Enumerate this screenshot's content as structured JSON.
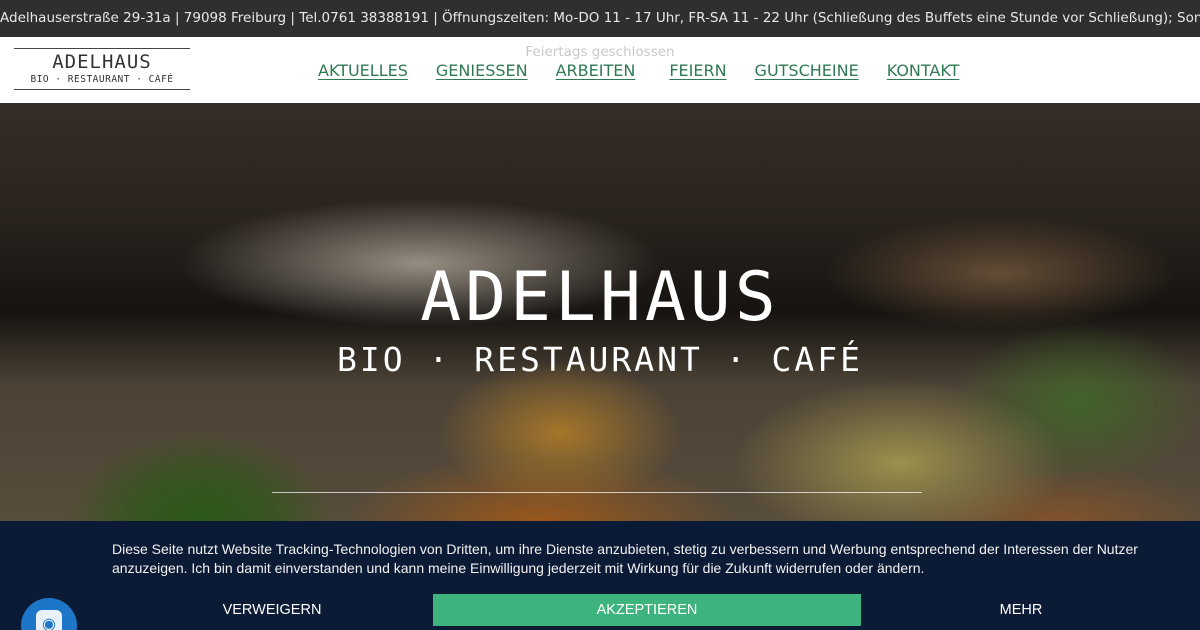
{
  "topbar": {
    "info": "Adelhauserstraße 29-31a | 79098 Freiburg | Tel.0761 38388191 | Öffnungszeiten: Mo-DO 11 - 17 Uhr, FR-SA 11 - 22 Uhr (Schließung des Buffets eine Stunde vor Schließung); Sonn- und",
    "info_wrap": "Feiertags geschlossen"
  },
  "logo": {
    "main": "ADELHAUS",
    "sub": "BIO · RESTAURANT · CAFÉ"
  },
  "nav": {
    "items": [
      {
        "label": "AKTUELLES"
      },
      {
        "label": "GENIESSEN"
      },
      {
        "label": "ARBEITEN"
      },
      {
        "label": "FEIERN"
      },
      {
        "label": "GUTSCHEINE"
      },
      {
        "label": "KONTAKT"
      }
    ]
  },
  "hero": {
    "title": "ADELHAUS",
    "subtitle": "BIO · RESTAURANT · CAFÉ"
  },
  "cookie": {
    "text": "Diese Seite nutzt Website Tracking-Technologien von Dritten, um ihre Dienste anzubieten, stetig zu verbessern und Werbung entsprechend der Interessen der Nutzer anzuzeigen. Ich bin damit einverstanden und kann meine Einwilligung jederzeit mit Wirkung für die Zukunft widerrufen oder ändern.",
    "decline_label": "VERWEIGERN",
    "accept_label": "AKZEPTIEREN",
    "more_label": "MEHR"
  },
  "icons": {
    "privacy": "fingerprint-icon"
  },
  "colors": {
    "nav_link": "#2f7a55",
    "topbar_bg": "#2f2f2f",
    "cookie_bg": "#0b1b35",
    "accept_bg": "#3db47d",
    "privacy_button": "#1e76c8"
  }
}
